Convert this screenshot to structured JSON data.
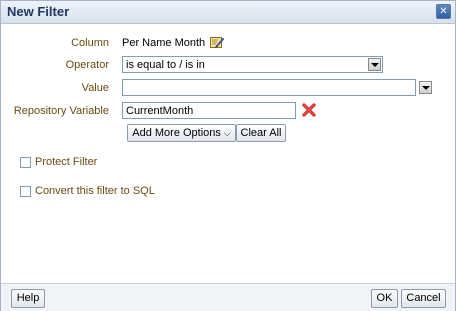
{
  "dialog": {
    "title": "New Filter",
    "close_glyph": "✕"
  },
  "form": {
    "column": {
      "label": "Column",
      "value": "Per Name Month",
      "edit_icon": "edit-pencil-icon"
    },
    "operator": {
      "label": "Operator",
      "selected": "is equal to / is in"
    },
    "value": {
      "label": "Value",
      "selected": ""
    },
    "repository_variable": {
      "label": "Repository Variable",
      "value": "CurrentMonth",
      "delete_icon": "red-x-delete-icon"
    },
    "add_more_options_label": "Add More Options",
    "add_more_options_chevron": "⌵",
    "clear_all_label": "Clear All"
  },
  "options": {
    "protect_filter_label": "Protect Filter",
    "protect_filter_checked": false,
    "convert_sql_label": "Convert this filter to SQL",
    "convert_sql_checked": false
  },
  "footer": {
    "help_label": "Help",
    "ok_label": "OK",
    "cancel_label": "Cancel"
  },
  "colors": {
    "title_text": "#203860",
    "label_text": "#6b4a10",
    "delete_red": "#d32020"
  }
}
